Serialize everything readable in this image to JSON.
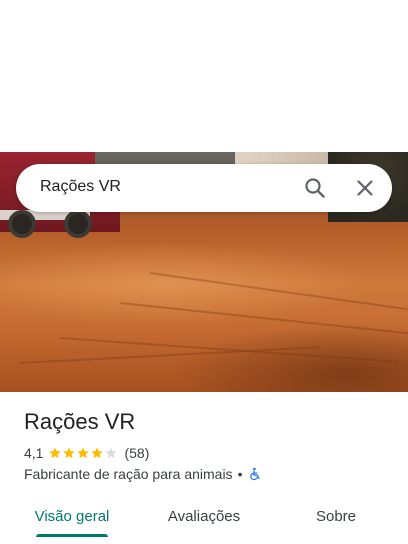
{
  "search": {
    "query": "Rações VR"
  },
  "place": {
    "name": "Rações VR",
    "rating_value": "4,1",
    "rating_stars": 4.1,
    "review_count": "(58)",
    "category": "Fabricante de ração para animais",
    "separator": "•"
  },
  "tabs": [
    {
      "label": "Visão geral",
      "active": true
    },
    {
      "label": "Avaliações",
      "active": false
    },
    {
      "label": "Sobre",
      "active": false
    }
  ],
  "colors": {
    "accent": "#01796f",
    "star": "#fbbc04",
    "star_empty": "#dadce0",
    "accessibility": "#1a73e8"
  },
  "icons": {
    "search": "search-icon",
    "close": "close-icon",
    "accessibility": "wheelchair-icon"
  }
}
